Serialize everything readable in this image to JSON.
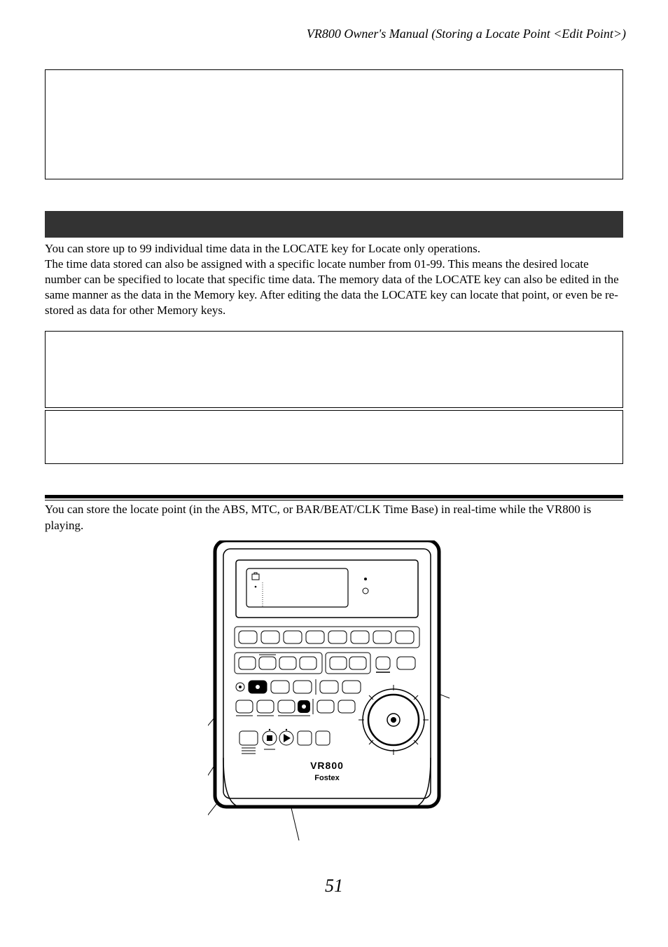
{
  "header": "VR800 Owner's Manual (Storing a Locate Point <Edit Point>)",
  "para1_line1": "You can store up to 99 individual time data in the LOCATE key for Locate only operations.",
  "para1_rest": "The time data stored can also be assigned with a specific locate number from 01-99.  This means the desired locate number can be specified to locate that specific time data.  The memory data of the LOCATE key can also be edited in the same manner as the data in the Memory key.  After editing the data the LOCATE key can locate that point, or even be re-stored as data for other Memory keys.",
  "para2": "You can store the locate point (in the ABS, MTC, or BAR/BEAT/CLK Time Base) in real-time while the VR800 is playing.",
  "device_brand_model": "VR800",
  "device_brand": "Fostex",
  "page_number": "51"
}
